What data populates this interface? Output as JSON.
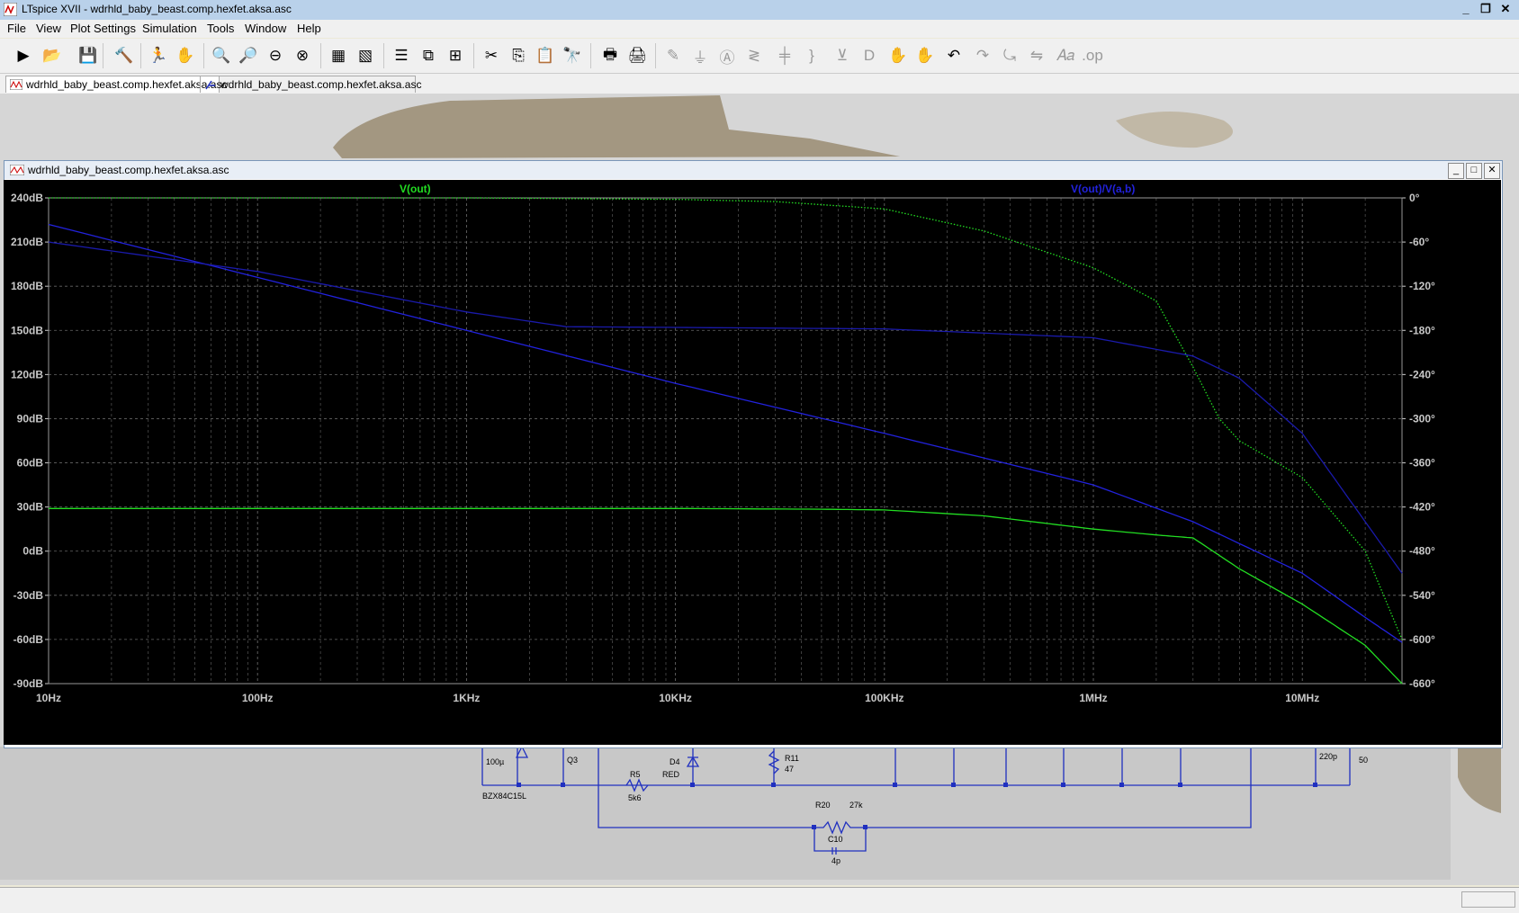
{
  "window": {
    "title": "LTspice XVII - wdrhld_baby_beast.comp.hexfet.aksa.asc"
  },
  "menu": [
    {
      "label": "File"
    },
    {
      "label": "View"
    },
    {
      "label": "Plot Settings"
    },
    {
      "label": "Simulation"
    },
    {
      "label": "Tools"
    },
    {
      "label": "Window"
    },
    {
      "label": "Help"
    }
  ],
  "tabs": [
    {
      "label": "wdrhld_baby_beast.comp.hexfet.aksa.asc",
      "icon": "waveform-icon"
    },
    {
      "label": "wdrhld_baby_beast.comp.hexfet.aksa.asc",
      "icon": "schematic-icon"
    }
  ],
  "plot_window": {
    "title": "wdrhld_baby_beast.comp.hexfet.aksa.asc"
  },
  "traces": [
    {
      "label": "V(out)",
      "color": "#22dd22"
    },
    {
      "label": "V(out)/V(a,b)",
      "color": "#2222dd"
    }
  ],
  "schematic": {
    "labels": [
      "100µ",
      "BZX84C15L",
      "Q3",
      "R5",
      "5k6",
      "D4",
      "RED",
      "R11",
      "47",
      "R20",
      "27k",
      "C10",
      "4p",
      "220p",
      "50"
    ]
  },
  "chart_data": {
    "type": "line",
    "xscale": "log",
    "xlim": [
      10,
      30000000
    ],
    "x_ticks": [
      "10Hz",
      "100Hz",
      "1KHz",
      "10KHz",
      "100KHz",
      "1MHz",
      "10MHz"
    ],
    "y_left_ticks": [
      "240dB",
      "210dB",
      "180dB",
      "150dB",
      "120dB",
      "90dB",
      "60dB",
      "30dB",
      "0dB",
      "-30dB",
      "-60dB",
      "-90dB"
    ],
    "y_right_ticks": [
      "0°",
      "-60°",
      "-120°",
      "-180°",
      "-240°",
      "-300°",
      "-360°",
      "-420°",
      "-480°",
      "-540°",
      "-600°",
      "-660°"
    ],
    "ylim_left": [
      -90,
      240
    ],
    "ylim_right": [
      -660,
      0
    ],
    "grid": true,
    "series": [
      {
        "name": "V(out)",
        "axis": "left",
        "style": "solid",
        "color": "#22dd22",
        "x": [
          10,
          100,
          1000,
          10000,
          50000,
          100000,
          300000,
          1000000,
          2000000,
          3000000,
          5000000,
          10000000,
          20000000,
          30000000
        ],
        "y": [
          29,
          29,
          29,
          29,
          28.5,
          28,
          24,
          15,
          11,
          9,
          -12,
          -36,
          -64,
          -90
        ]
      },
      {
        "name": "V(out)/V(a,b)",
        "axis": "left",
        "style": "solid",
        "color": "#2222dd",
        "x": [
          10,
          100,
          1000,
          10000,
          100000,
          1000000,
          3000000,
          10000000,
          20000000,
          30000000
        ],
        "y": [
          222,
          186,
          150,
          114,
          80,
          45,
          20,
          -15,
          -45,
          -62
        ]
      },
      {
        "name": "V(out) phase",
        "axis": "right",
        "style": "dotted",
        "color": "#22dd22",
        "x": [
          10,
          1000,
          10000,
          30000,
          100000,
          300000,
          1000000,
          2000000,
          3000000,
          4000000,
          5000000,
          10000000,
          20000000,
          30000000
        ],
        "y": [
          0,
          0,
          -2,
          -5,
          -15,
          -45,
          -95,
          -140,
          -230,
          -300,
          -330,
          -380,
          -480,
          -600
        ]
      },
      {
        "name": "V(out)/V(a,b) phase",
        "axis": "right",
        "style": "solid",
        "color": "#1a1aaa",
        "x": [
          10,
          100,
          1000,
          3000,
          10000,
          100000,
          1000000,
          3000000,
          5000000,
          10000000,
          20000000,
          30000000
        ],
        "y": [
          -60,
          -100,
          -155,
          -175,
          -176,
          -178,
          -190,
          -215,
          -245,
          -320,
          -440,
          -510
        ]
      }
    ]
  }
}
